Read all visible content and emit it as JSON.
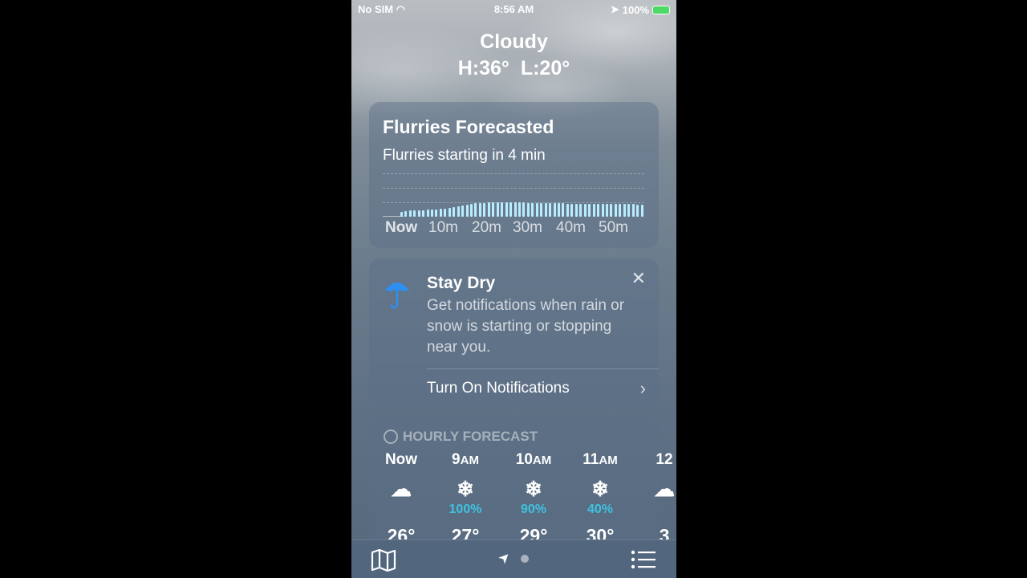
{
  "status": {
    "carrier": "No SIM",
    "time": "8:56 AM",
    "battery": "100%"
  },
  "header": {
    "condition": "Cloudy",
    "high_low": "H:36°  L:20°"
  },
  "precip_card": {
    "title": "Flurries Forecasted",
    "subtitle": "Flurries starting in 4 min",
    "x_labels": [
      "Now",
      "10m",
      "20m",
      "30m",
      "40m",
      "50m"
    ],
    "intensity": [
      0,
      0,
      0,
      0,
      0.12,
      0.13,
      0.14,
      0.14,
      0.15,
      0.15,
      0.16,
      0.16,
      0.17,
      0.18,
      0.19,
      0.2,
      0.22,
      0.24,
      0.26,
      0.28,
      0.3,
      0.31,
      0.32,
      0.32,
      0.33,
      0.33,
      0.34,
      0.34,
      0.34,
      0.33,
      0.33,
      0.33,
      0.33,
      0.32,
      0.32,
      0.32,
      0.32,
      0.31,
      0.31,
      0.31,
      0.31,
      0.31,
      0.3,
      0.3,
      0.3,
      0.3,
      0.3,
      0.3,
      0.3,
      0.3,
      0.29,
      0.29,
      0.29,
      0.29,
      0.29,
      0.29,
      0.29,
      0.29,
      0.28,
      0.28
    ],
    "bar_color": "#b9ecff"
  },
  "notify_card": {
    "icon": "umbrella-icon",
    "title": "Stay Dry",
    "description": "Get notifications when rain or snow is starting or stopping near you.",
    "button": "Turn On Notifications"
  },
  "hourly": {
    "title": "HOURLY FORECAST",
    "items": [
      {
        "hour": "Now",
        "suffix": "",
        "icon": "cloud",
        "precip": "",
        "temp": "26°"
      },
      {
        "hour": "9",
        "suffix": "AM",
        "icon": "snowflake",
        "precip": "100%",
        "temp": "27°"
      },
      {
        "hour": "10",
        "suffix": "AM",
        "icon": "snowflake",
        "precip": "90%",
        "temp": "29°"
      },
      {
        "hour": "11",
        "suffix": "AM",
        "icon": "snowflake",
        "precip": "40%",
        "temp": "30°"
      },
      {
        "hour": "12",
        "suffix": "",
        "icon": "cloud",
        "precip": "",
        "temp": "3"
      }
    ],
    "precip_color": "#3ec3e0"
  },
  "tabbar": {
    "left": "map-icon",
    "center": "location-icon",
    "right": "list-icon"
  }
}
